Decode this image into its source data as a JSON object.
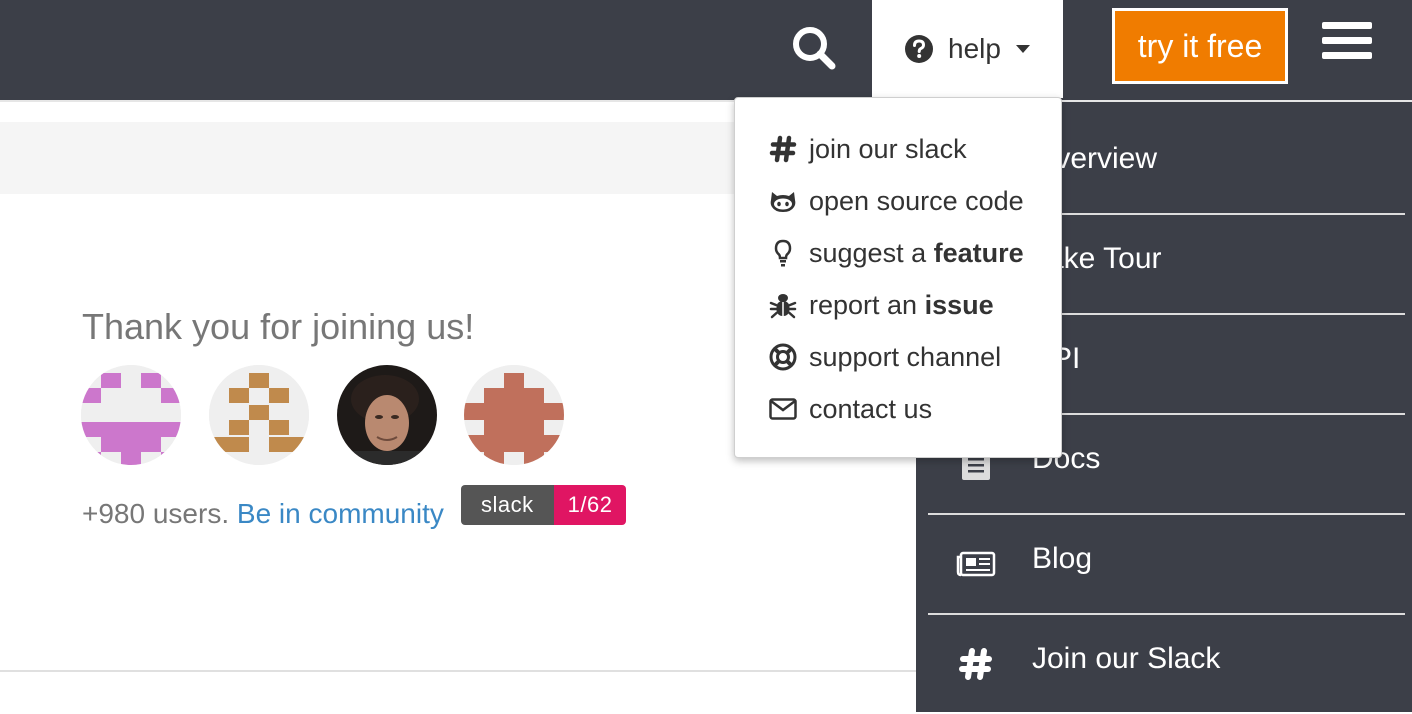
{
  "header": {
    "help_label": "help",
    "try_label": "try it free",
    "accent_color": "#f07c00",
    "bar_color": "#3c3f48"
  },
  "help_menu": {
    "items": [
      {
        "icon": "slack-hash-icon",
        "text": "join our slack",
        "bold": ""
      },
      {
        "icon": "github-icon",
        "text": "open source code",
        "bold": ""
      },
      {
        "icon": "lightbulb-icon",
        "text": "suggest a ",
        "bold": "feature"
      },
      {
        "icon": "bug-icon",
        "text": "report an ",
        "bold": "issue"
      },
      {
        "icon": "lifebuoy-icon",
        "text": "support channel",
        "bold": ""
      },
      {
        "icon": "envelope-icon",
        "text": "contact us",
        "bold": ""
      }
    ]
  },
  "main": {
    "thanks_text": "Thank you for joining us!",
    "users_count": "+980 users.",
    "community_link": "Be in community",
    "slack_badge_label": "slack",
    "slack_badge_count": "1/62"
  },
  "side_nav": {
    "items": [
      {
        "icon": "overview-icon",
        "label": "Overview"
      },
      {
        "icon": "tour-icon",
        "label": "Take Tour"
      },
      {
        "icon": "api-icon",
        "label": "API"
      },
      {
        "icon": "docs-icon",
        "label": "Docs"
      },
      {
        "icon": "newspaper-icon",
        "label": "Blog"
      },
      {
        "icon": "slack-hash-icon",
        "label": "Join our Slack"
      }
    ]
  }
}
